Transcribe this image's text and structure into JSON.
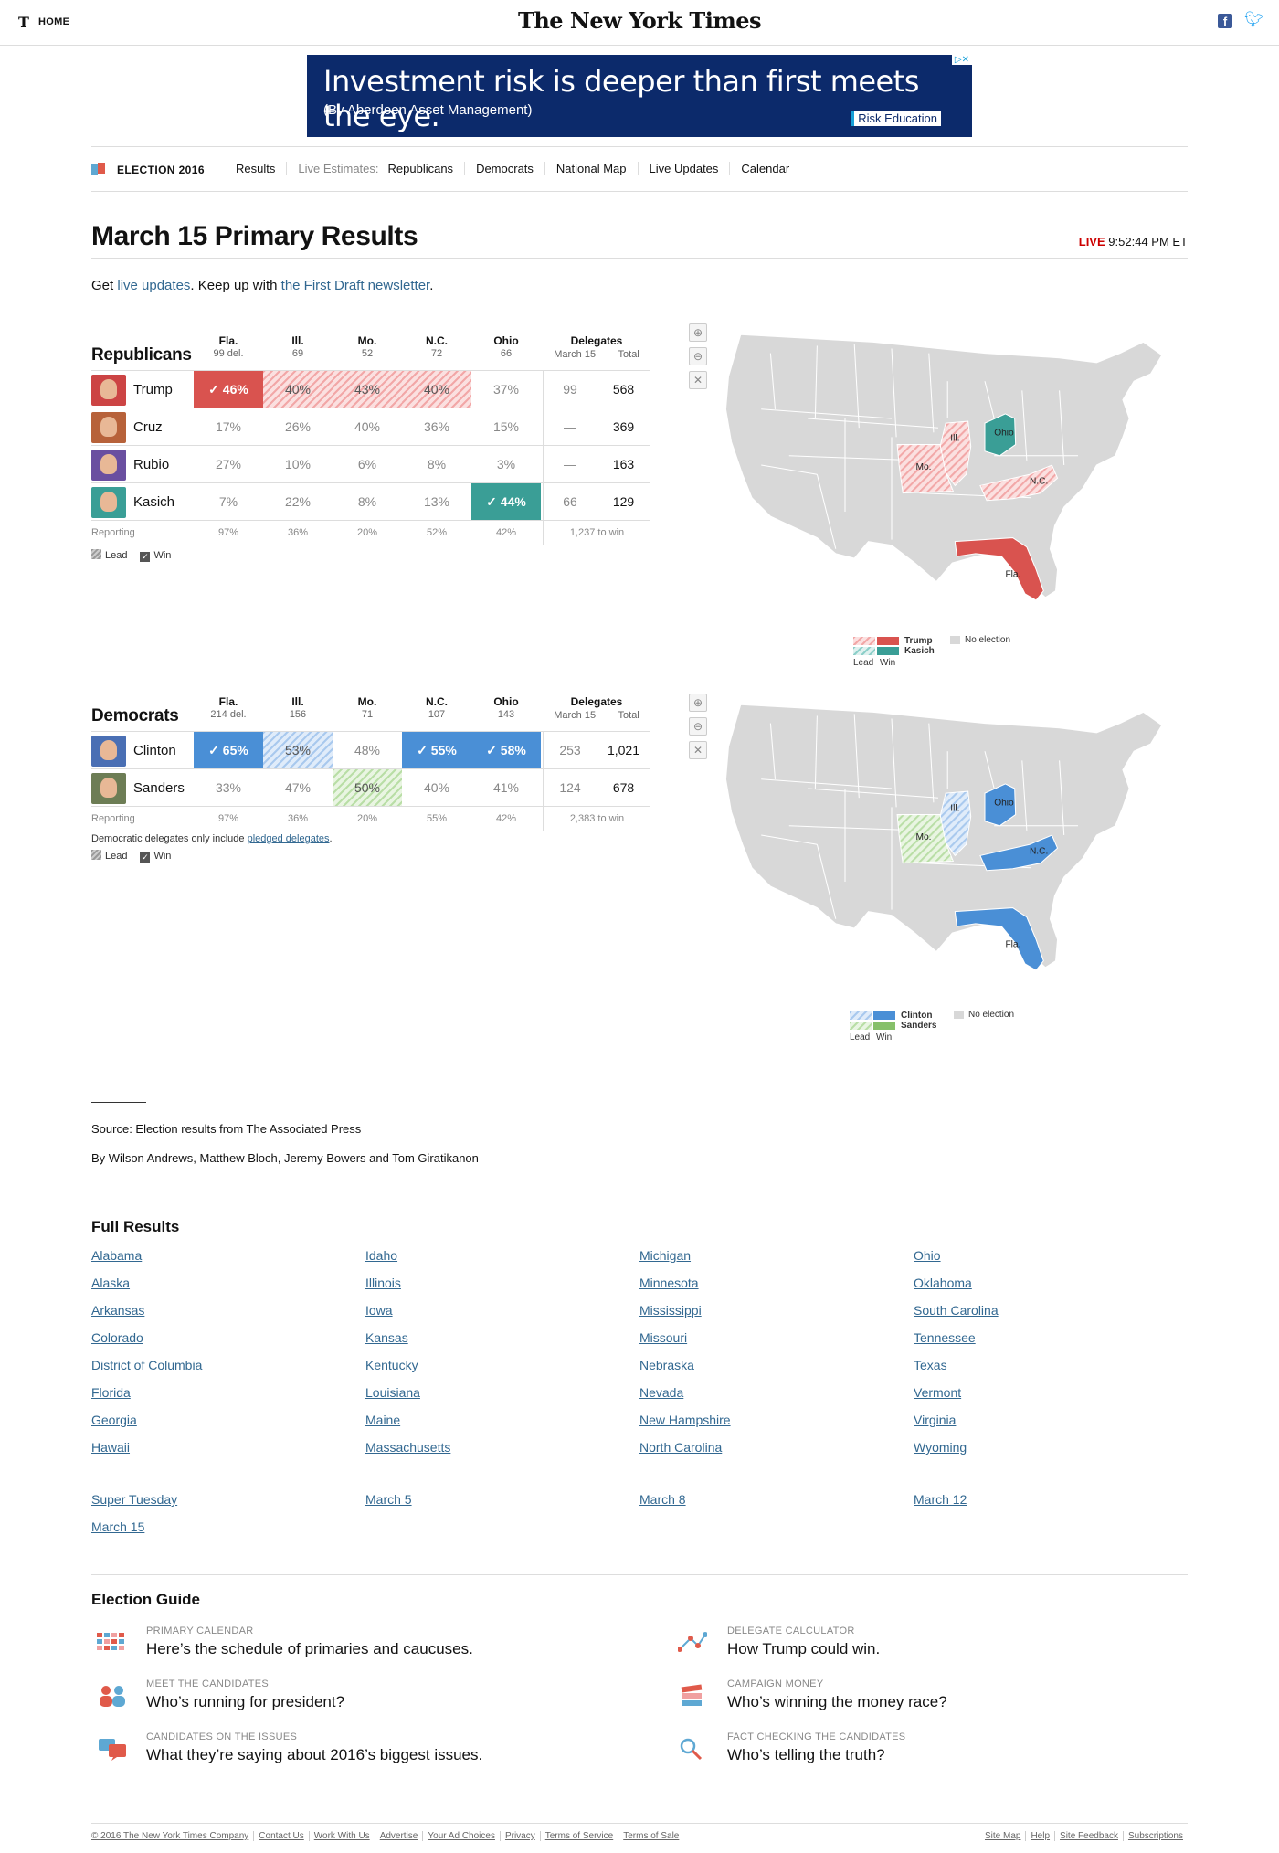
{
  "topbar": {
    "home": "HOME",
    "masthead": "The New York Times"
  },
  "ad": {
    "headline": "Investment risk is deeper than first meets the eye.",
    "sub": "(By Aberdeen Asset Management)",
    "badge": "Risk Education"
  },
  "nav": {
    "brand": "ELECTION 2016",
    "results": "Results",
    "live_estimates": "Live Estimates:",
    "republicans": "Republicans",
    "democrats": "Democrats",
    "national_map": "National Map",
    "live_updates": "Live Updates",
    "calendar": "Calendar"
  },
  "page": {
    "title": "March 15 Primary Results",
    "live": "LIVE",
    "time": "9:52:44 PM ET",
    "intro_get": "Get",
    "intro_live": "live updates",
    "intro_mid": ". Keep up with",
    "intro_newsletter": "the First Draft newsletter",
    "intro_end": "."
  },
  "colors": {
    "trump": "#d9534f",
    "kasich": "#3a9e96",
    "clinton": "#4a8fd6",
    "sanders": "#86c06a",
    "no_election": "#d8d8d8"
  },
  "states": [
    {
      "abbr": "Fla.",
      "name": "Florida"
    },
    {
      "abbr": "Ill.",
      "name": "Illinois"
    },
    {
      "abbr": "Mo.",
      "name": "Missouri"
    },
    {
      "abbr": "N.C.",
      "name": "North Carolina"
    },
    {
      "abbr": "Ohio",
      "name": "Ohio"
    }
  ],
  "rep": {
    "party": "Republicans",
    "delegates_head": "Delegates",
    "del_march": "March 15",
    "del_total": "Total",
    "state_dels": [
      "99 del.",
      "69",
      "52",
      "72",
      "66"
    ],
    "candidates": [
      {
        "name": "Trump",
        "results": [
          "46%",
          "40%",
          "43%",
          "40%",
          "37%"
        ],
        "status": [
          "win",
          "lead",
          "lead",
          "lead",
          ""
        ],
        "march15": "99",
        "total": "568"
      },
      {
        "name": "Cruz",
        "results": [
          "17%",
          "26%",
          "40%",
          "36%",
          "15%"
        ],
        "status": [
          "",
          "",
          "",
          "",
          ""
        ],
        "march15": "—",
        "total": "369"
      },
      {
        "name": "Rubio",
        "results": [
          "27%",
          "10%",
          "6%",
          "8%",
          "3%"
        ],
        "status": [
          "",
          "",
          "",
          "",
          ""
        ],
        "march15": "—",
        "total": "163"
      },
      {
        "name": "Kasich",
        "results": [
          "7%",
          "22%",
          "8%",
          "13%",
          "44%"
        ],
        "status": [
          "",
          "",
          "",
          "",
          "win"
        ],
        "march15": "66",
        "total": "129"
      }
    ],
    "reporting_label": "Reporting",
    "reporting": [
      "97%",
      "36%",
      "20%",
      "52%",
      "42%"
    ],
    "to_win": "1,237 to win",
    "legend_lead": "Lead",
    "legend_win": "Win",
    "map_legend": {
      "c1": "Trump",
      "c2": "Kasich",
      "lead": "Lead",
      "win": "Win",
      "none": "No election"
    }
  },
  "dem": {
    "party": "Democrats",
    "delegates_head": "Delegates",
    "del_march": "March 15",
    "del_total": "Total",
    "state_dels": [
      "214 del.",
      "156",
      "71",
      "107",
      "143"
    ],
    "candidates": [
      {
        "name": "Clinton",
        "results": [
          "65%",
          "53%",
          "48%",
          "55%",
          "58%"
        ],
        "status": [
          "win",
          "lead",
          "",
          "win",
          "win"
        ],
        "march15": "253",
        "total": "1,021"
      },
      {
        "name": "Sanders",
        "results": [
          "33%",
          "47%",
          "50%",
          "40%",
          "41%"
        ],
        "status": [
          "",
          "",
          "lead",
          "",
          ""
        ],
        "march15": "124",
        "total": "678"
      }
    ],
    "reporting_label": "Reporting",
    "reporting": [
      "97%",
      "36%",
      "20%",
      "55%",
      "42%"
    ],
    "to_win": "2,383 to win",
    "note_pre": "Democratic delegates only include",
    "note_link": "pledged delegates",
    "note_end": ".",
    "legend_lead": "Lead",
    "legend_win": "Win",
    "map_legend": {
      "c1": "Clinton",
      "c2": "Sanders",
      "lead": "Lead",
      "win": "Win",
      "none": "No election"
    }
  },
  "credits": {
    "source": "Source: Election results from The Associated Press",
    "byline": "By Wilson Andrews, Matthew Bloch, Jeremy Bowers and Tom Giratikanon"
  },
  "full_results": {
    "title": "Full Results",
    "columns": [
      [
        "Alabama",
        "Alaska",
        "Arkansas",
        "Colorado",
        "District of Columbia",
        "Florida",
        "Georgia",
        "Hawaii"
      ],
      [
        "Idaho",
        "Illinois",
        "Iowa",
        "Kansas",
        "Kentucky",
        "Louisiana",
        "Maine",
        "Massachusetts"
      ],
      [
        "Michigan",
        "Minnesota",
        "Mississippi",
        "Missouri",
        "Nebraska",
        "Nevada",
        "New Hampshire",
        "North Carolina"
      ],
      [
        "Ohio",
        "Oklahoma",
        "South Carolina",
        "Tennessee",
        "Texas",
        "Vermont",
        "Virginia",
        "Wyoming"
      ]
    ],
    "dates": [
      [
        "Super Tuesday",
        "March 15"
      ],
      [
        "March 5"
      ],
      [
        "March 8"
      ],
      [
        "March 12"
      ]
    ]
  },
  "guide": {
    "title": "Election Guide",
    "items": [
      {
        "kicker": "PRIMARY CALENDAR",
        "headline": "Here’s the schedule of primaries and caucuses.",
        "icon": "calendar-grid-icon"
      },
      {
        "kicker": "DELEGATE CALCULATOR",
        "headline": "How Trump could win.",
        "icon": "calculator-network-icon"
      },
      {
        "kicker": "MEET THE CANDIDATES",
        "headline": "Who’s running for president?",
        "icon": "people-icon"
      },
      {
        "kicker": "CAMPAIGN MONEY",
        "headline": "Who’s winning the money race?",
        "icon": "money-stack-icon"
      },
      {
        "kicker": "CANDIDATES ON THE ISSUES",
        "headline": "What they’re saying about 2016’s biggest issues.",
        "icon": "speech-bubbles-icon"
      },
      {
        "kicker": "FACT CHECKING THE CANDIDATES",
        "headline": "Who’s telling the truth?",
        "icon": "magnifier-icon"
      }
    ]
  },
  "footer": {
    "left": [
      "© 2016 The New York Times Company",
      "Contact Us",
      "Work With Us",
      "Advertise",
      "Your Ad Choices",
      "Privacy",
      "Terms of Service",
      "Terms of Sale"
    ],
    "right": [
      "Site Map",
      "Help",
      "Site Feedback",
      "Subscriptions"
    ]
  }
}
